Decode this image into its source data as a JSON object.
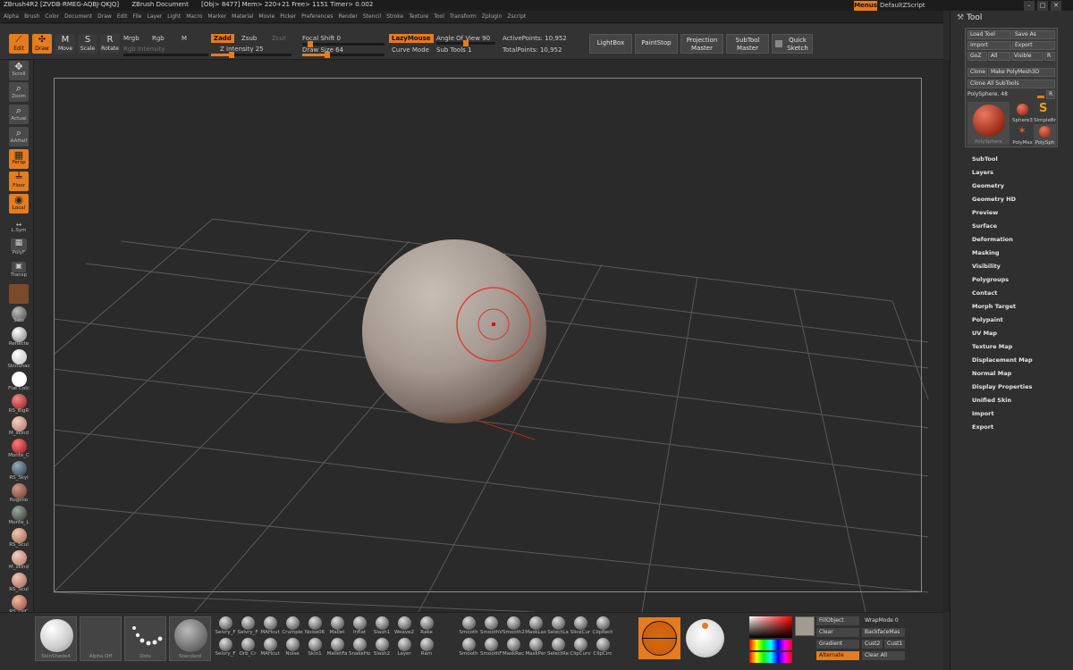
{
  "titlebar": {
    "app": "ZBrush4R2 [ZVDB-RMEG-AQBJ-QKJQ]",
    "doc": "ZBrush Document",
    "stats": "[Obj> 8477]  Mem> 220+21  Free> 1151  Timer> 0.002",
    "menus_button": "Menus",
    "script": "DefaultZScript"
  },
  "menubar": [
    "Alpha",
    "Brush",
    "Color",
    "Document",
    "Draw",
    "Edit",
    "File",
    "Layer",
    "Light",
    "Macro",
    "Marker",
    "Material",
    "Movie",
    "Picker",
    "Preferences",
    "Render",
    "Stencil",
    "Stroke",
    "Texture",
    "Tool",
    "Transform",
    "Zplugin",
    "Zscript"
  ],
  "toolbar": {
    "edit": "Edit",
    "draw": "Draw",
    "move": "Move",
    "scale": "Scale",
    "rotate": "Rotate",
    "mrgb": "Mrgb",
    "rgb": "Rgb",
    "m": "M",
    "rgb_intensity": "Rgb Intensity",
    "zadd": "Zadd",
    "zsub": "Zsub",
    "zcut": "Zcut",
    "z_intensity": "Z Intensity 25",
    "focal_shift": "Focal Shift 0",
    "draw_size": "Draw Size 64",
    "lazymouse": "LazyMouse",
    "curve_mode": "Curve Mode",
    "angle_of_view": "Angle Of View 90",
    "sub_tools": "Sub Tools 1",
    "active_points": "ActivePoints: 10,952",
    "total_points": "TotalPoints: 10,952",
    "lightbox": "LightBox",
    "paintstop": "PaintStop",
    "projection_master": "Projection Master",
    "subtool_master": "SubTool Master",
    "quick_sketch": "Quick Sketch",
    "z_intensity_level": 0.25,
    "draw_size_level": 0.06,
    "focal_shift_level": 0.5
  },
  "leftshelf": {
    "buttons": [
      "Scroll",
      "Zoom",
      "Actual",
      "AAHalf",
      "Persp",
      "Floor",
      "Local",
      "L.Sym",
      "PolyF",
      "Transp"
    ],
    "materials": [
      "Solo",
      "Reflecte",
      "SkinShac",
      "Flat Colc",
      "RS_BigR",
      "M_skind",
      "Monte_C",
      "RS_Skyl",
      "Rogelio",
      "Monte_L",
      "RS_Scul",
      "M_skind",
      "RS_Scul",
      "RS_OilC"
    ]
  },
  "bottom": {
    "thumbs": [
      "SkinShade4",
      "Alpha Off",
      "Dots",
      "Standard"
    ],
    "brushes_row1": [
      "Selvry_F",
      "Selvry_F",
      "MAHcut",
      "Crumple",
      "Noise06",
      "Mallet",
      "Inflat",
      "Slash1",
      "Weave2",
      "Rake"
    ],
    "brushes_row2": [
      "Selvry_F",
      "Orb_Cr",
      "MAHcut",
      "Noise",
      "Skin1",
      "MalletFa",
      "SnakeHo",
      "Slash2",
      "Layer",
      "Ram"
    ],
    "brushes_row3": [
      "Smooth",
      "SmoothV",
      "Smooth2",
      "MaskLas",
      "SelectLa",
      "SliceCur",
      "ClipRect"
    ],
    "brushes_row4": [
      "Smooth",
      "SmoothF",
      "MaskRec",
      "MaskPer",
      "SelectRe",
      "ClipCurv",
      "ClipCirc"
    ],
    "color": {
      "fill_object": "FillObject",
      "wrapmode": "WrapMode 0",
      "clear": "Clear",
      "backfacemask": "BackfaceMas",
      "gradient": "Gradient",
      "cust2": "Cust2",
      "cust1": "Cust1",
      "alternate": "Alternate",
      "clear_all": "Clear All",
      "main_color": "#a39a92"
    }
  },
  "rightpanel": {
    "title": "Tool",
    "buttons": {
      "load_tool": "Load Tool",
      "save_as": "Save As",
      "import": "Import",
      "export": "Export",
      "goz": "GoZ",
      "all": "All",
      "visible": "Visible",
      "r": "R",
      "clone": "Clone",
      "make_polymesh": "Make PolyMesh3D",
      "clone_all": "Clone  All SubTools",
      "polysphere": "PolySphere. 48"
    },
    "thumbs": [
      "PolySphere",
      "Sphere3",
      "SimpleBr",
      "PolyMes",
      "PolySph"
    ],
    "menu": [
      "SubTool",
      "Layers",
      "Geometry",
      "Geometry HD",
      "Preview",
      "Surface",
      "Deformation",
      "Masking",
      "Visibility",
      "Polygroups",
      "Contact",
      "Morph Target",
      "Polypaint",
      "UV Map",
      "Texture Map",
      "Displacement Map",
      "Normal Map",
      "Display Properties",
      "Unified Skin",
      "Import",
      "Export"
    ]
  },
  "colors": {
    "accent": "#e57c1e",
    "panel": "#2f2f2f",
    "canvas": "#2a2a2a"
  }
}
